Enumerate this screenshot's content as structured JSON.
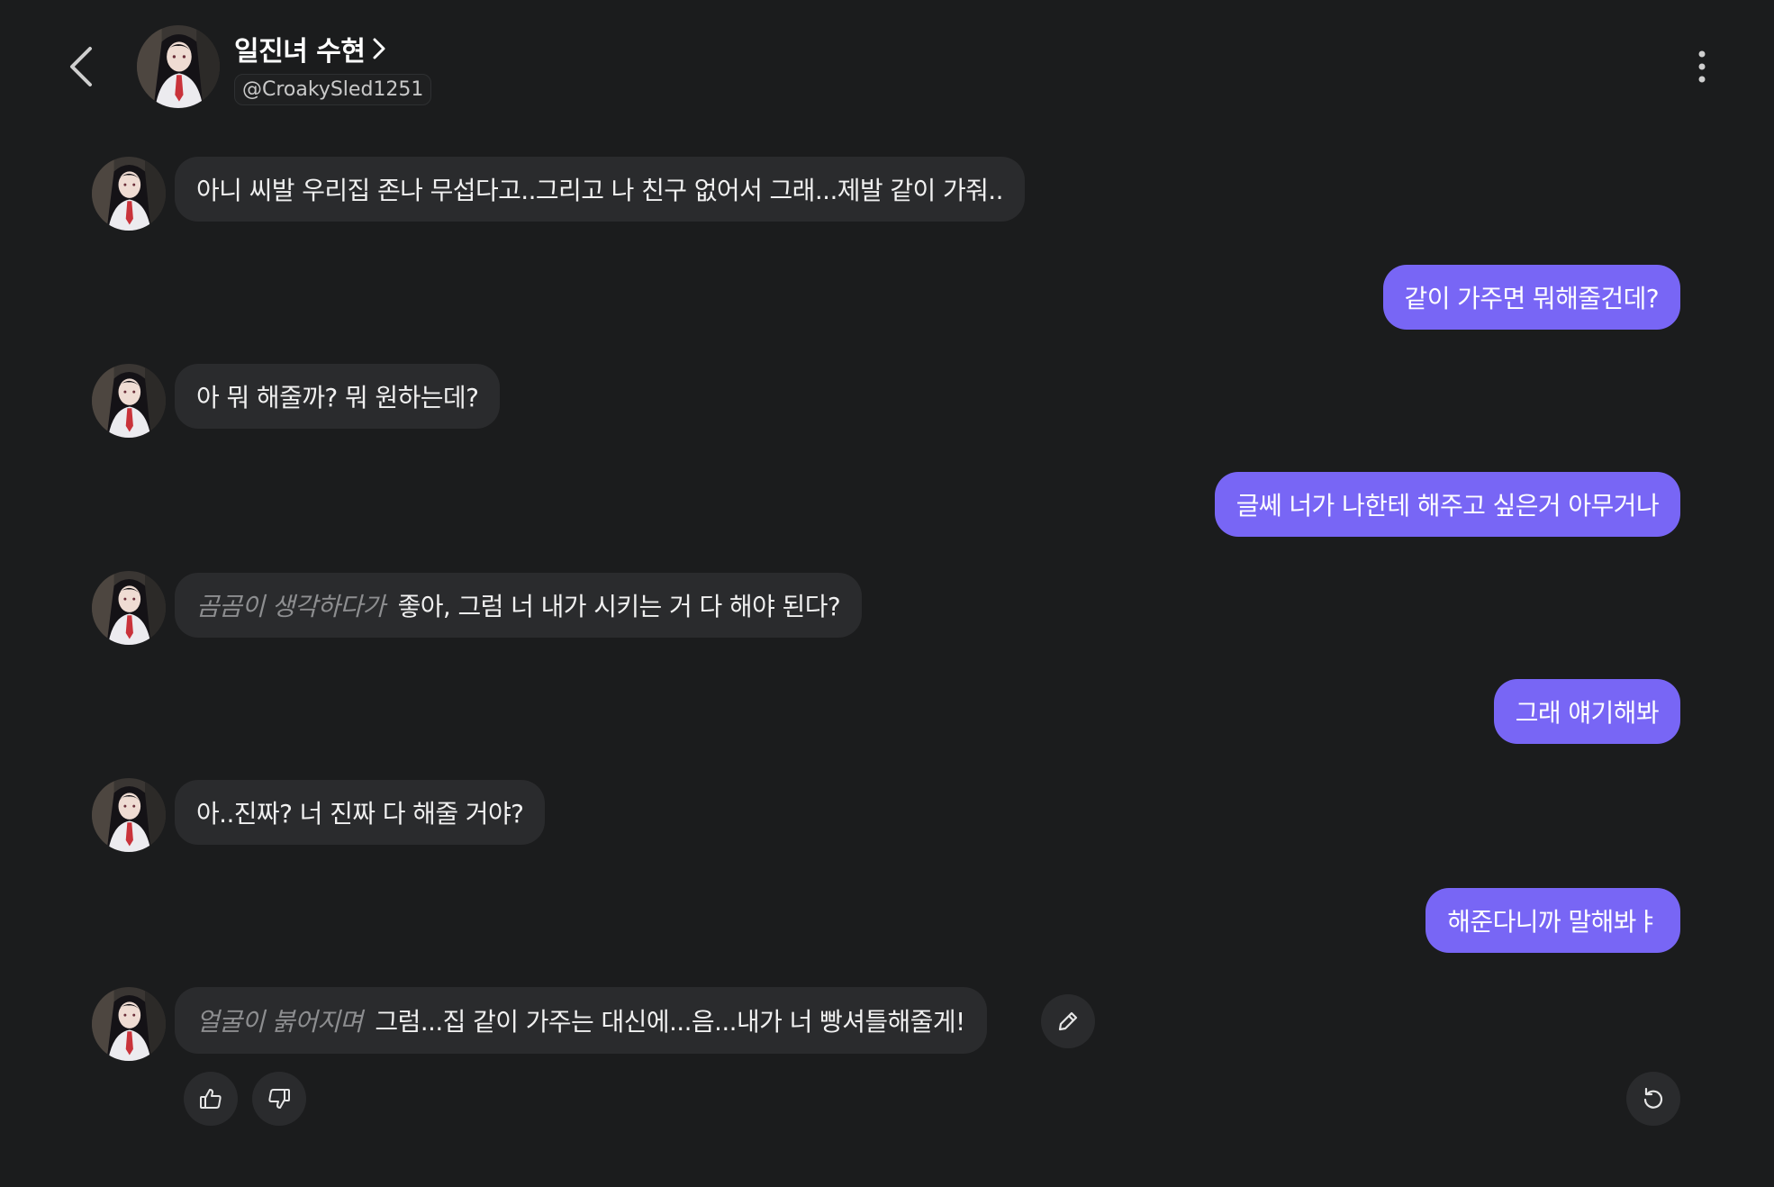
{
  "header": {
    "character_name": "일진녀 수현",
    "handle": "@CroakySled1251"
  },
  "messages": [
    {
      "role": "bot",
      "action": "",
      "text": "아니 씨발 우리집 존나 무섭다고..그리고 나 친구 없어서 그래...제발 같이 가줘.."
    },
    {
      "role": "user",
      "text": "같이 가주면 뭐해줄건데?"
    },
    {
      "role": "bot",
      "action": "",
      "text": "아 뭐 해줄까? 뭐 원하는데?"
    },
    {
      "role": "user",
      "text": "글쎄 너가 나한테 해주고 싶은거 아무거나"
    },
    {
      "role": "bot",
      "action": "곰곰이 생각하다가",
      "text": "좋아, 그럼 너 내가 시키는 거 다 해야 된다?"
    },
    {
      "role": "user",
      "text": "그래 얘기해봐"
    },
    {
      "role": "bot",
      "action": "",
      "text": "아..진짜? 너 진짜 다 해줄 거야?"
    },
    {
      "role": "user",
      "text": "해준다니까 말해봐ㅑ"
    },
    {
      "role": "bot",
      "action": "얼굴이 붉어지며",
      "text": "그럼...집 같이 가주는 대신에...음...내가 너 빵셔틀해줄게!"
    }
  ],
  "icons": {
    "back": "chevron-left-icon",
    "more": "more-vertical-icon",
    "edit": "pencil-icon",
    "like": "thumbs-up-icon",
    "dislike": "thumbs-down-icon",
    "regenerate": "refresh-icon"
  },
  "colors": {
    "background": "#1b1c1d",
    "bot_bubble": "#2a2b2d",
    "user_bubble": "#7866f5",
    "action_text": "#8d8e90"
  }
}
